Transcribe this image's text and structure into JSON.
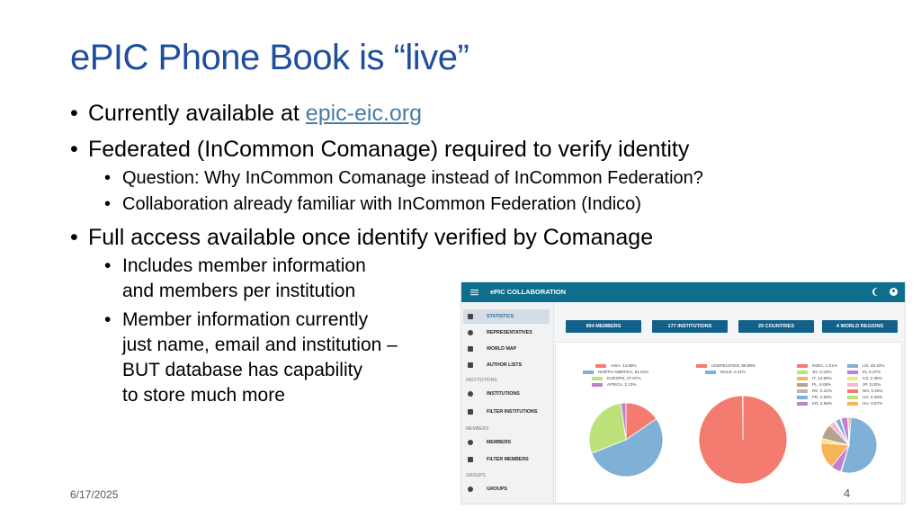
{
  "slide": {
    "title": "ePIC Phone Book is “live”",
    "bullet1_prefix": "Currently  available at ",
    "bullet1_link": "epic-eic.org",
    "bullet2": "Federated (InCommon Comanage) required to verify identity",
    "bullet2_sub1": "Question: Why InCommon Comanage instead of InCommon Federation?",
    "bullet2_sub2": "Collaboration already familiar with InCommon Federation (Indico)",
    "bullet3": "Full access available once identify verified by Comanage",
    "bullet3_sub1_l1": "Includes member information",
    "bullet3_sub1_l2": "and members per institution",
    "bullet3_sub2_l1": "Member information currently",
    "bullet3_sub2_l2": "just name, email and institution –",
    "bullet3_sub2_l3": "BUT database has capability",
    "bullet3_sub2_l4": "to store much more",
    "date": "6/17/2025",
    "page_number": "4"
  },
  "app": {
    "title": "ePIC COLLABORATION",
    "colors": {
      "topbar": "#0d6f8b",
      "card": "#11618a"
    },
    "sidebar": {
      "items_top": [
        {
          "label": "STATISTICS",
          "icon": "chart-icon",
          "selected": true
        },
        {
          "label": "REPRESENTATIVES",
          "icon": "people-icon"
        },
        {
          "label": "WORLD MAP",
          "icon": "map-icon"
        },
        {
          "label": "AUTHOR LISTS",
          "icon": "list-icon"
        }
      ],
      "section_institutions": "INSTITUTIONS",
      "items_institutions": [
        {
          "label": "INSTITUTIONS",
          "icon": "globe-icon"
        },
        {
          "label": "FILTER INSTITUTIONS",
          "icon": "filter-list-icon"
        }
      ],
      "section_members": "MEMBERS",
      "items_members": [
        {
          "label": "MEMBERS",
          "icon": "people-icon"
        },
        {
          "label": "FILTER MEMBERS",
          "icon": "filter-list-icon"
        }
      ],
      "section_groups": "GROUPS",
      "items_groups": [
        {
          "label": "GROUPS",
          "icon": "people-icon"
        }
      ]
    },
    "cards": [
      "894 MEMBERS",
      "177 INSTITUTIONS",
      "29 COUNTRIES",
      "4 WORLD REGIONS"
    ],
    "chart_data": [
      {
        "type": "pie",
        "legend": [
          {
            "label": "ASIA, 14.88%",
            "value": 14.88,
            "color": "#f37b6f"
          },
          {
            "label": "NORTH AMERICA, 51.91%",
            "value": 51.91,
            "color": "#7fb1d8"
          },
          {
            "label": "EUROPE, 27.87%",
            "value": 27.87,
            "color": "#bde27b"
          },
          {
            "label": "AFRICA, 2.13%",
            "value": 2.13,
            "color": "#c07fd0"
          }
        ]
      },
      {
        "type": "pie",
        "legend": [
          {
            "label": "UNSPECIFIED, 99.89%",
            "value": 99.89,
            "color": "#f37b6f"
          },
          {
            "label": "MALE, 0.11%",
            "value": 0.11,
            "color": "#7fb1d8"
          }
        ]
      },
      {
        "type": "pie",
        "legend": [
          {
            "label": "INDIA, 1.01%",
            "value": 1.01,
            "color": "#f37b6f"
          },
          {
            "label": "US, 48.22%",
            "value": 48.22,
            "color": "#7fb1d8"
          },
          {
            "label": "JO, 0.34%",
            "value": 0.34,
            "color": "#bde27b"
          },
          {
            "label": "IN, 5.37%",
            "value": 5.37,
            "color": "#c07fd0"
          },
          {
            "label": "IT, 13.88%",
            "value": 13.88,
            "color": "#f7b35b"
          },
          {
            "label": "CZ, 2.35%",
            "value": 2.35,
            "color": "#f2e77a"
          },
          {
            "label": "PL, 8.08%",
            "value": 8.08,
            "color": "#b5a28e"
          },
          {
            "label": "JP, 3.02%",
            "value": 3.02,
            "color": "#f3b8d9"
          },
          {
            "label": "RK, 0.22%",
            "value": 0.22,
            "color": "#b6b6b6"
          },
          {
            "label": "NO, 0.45%",
            "value": 0.45,
            "color": "#f37b6f"
          },
          {
            "label": "FR, 2.60%",
            "value": 2.6,
            "color": "#7fb1d8"
          },
          {
            "label": "UA, 0.45%",
            "value": 0.45,
            "color": "#bde27b"
          },
          {
            "label": "KR, 3.58%",
            "value": 3.58,
            "color": "#c07fd0"
          },
          {
            "label": "HU, 0.67%",
            "value": 0.67,
            "color": "#f7b35b"
          }
        ]
      }
    ]
  }
}
